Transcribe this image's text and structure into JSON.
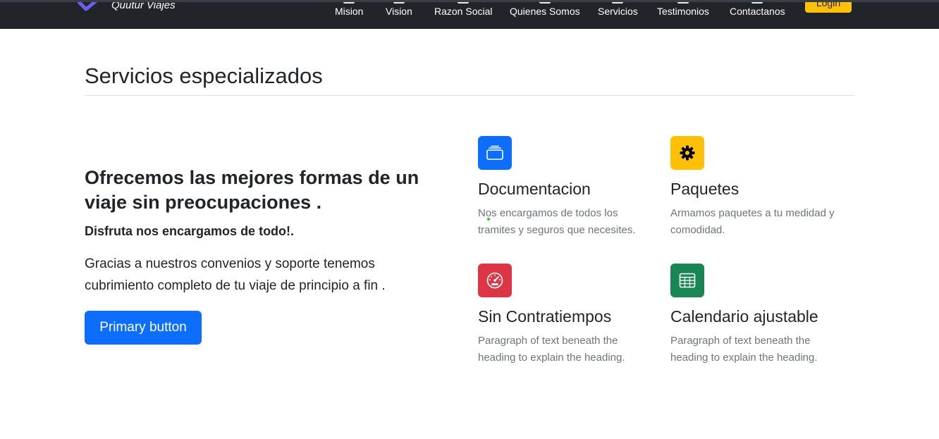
{
  "navbar": {
    "brand": "Quutur Viajes",
    "links": [
      "Mision",
      "Vision",
      "Razon Social",
      "Quienes Somos",
      "Servicios",
      "Testimonios",
      "Contactanos"
    ],
    "login_label": "Login"
  },
  "section": {
    "title": "Servicios especializados"
  },
  "hero": {
    "heading": "Ofrecemos las mejores formas de un viaje sin preocupaciones .",
    "subheading": "Disfruta nos encargamos de todo!.",
    "text": "Gracias a nuestros convenios y soporte tenemos cubrimiento completo de tu viaje de principio a fin .",
    "button_label": "Primary button"
  },
  "features": [
    {
      "icon": "collection-icon",
      "color": "#0d6efd",
      "title": "Documentacion",
      "description": "Nos encargamos de todos los tramites y seguros que necesites."
    },
    {
      "icon": "gear-icon",
      "color": "#ffc107",
      "title": "Paquetes",
      "description": "Armamos paquetes a tu medidad y comodidad."
    },
    {
      "icon": "speedometer-icon",
      "color": "#dc3545",
      "title": "Sin Contratiempos",
      "description": "Paragraph of text beneath the heading to explain the heading."
    },
    {
      "icon": "table-icon",
      "color": "#198754",
      "title": "Calendario ajustable",
      "description": "Paragraph of text beneath the heading to explain the heading."
    }
  ]
}
